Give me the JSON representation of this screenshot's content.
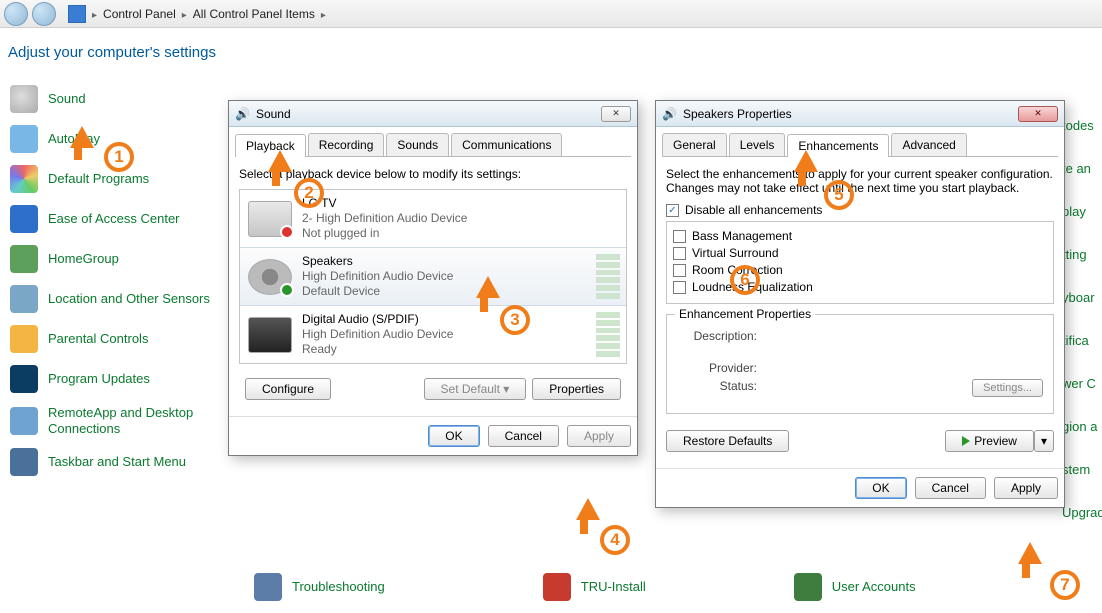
{
  "breadcrumb": {
    "items": [
      "Control Panel",
      "All Control Panel Items"
    ]
  },
  "heading": "Adjust your computer's settings",
  "sidebar": {
    "items": [
      "Sound",
      "AutoPlay",
      "Default Programs",
      "Ease of Access Center",
      "HomeGroup",
      "Location and Other Sensors",
      "Parental Controls",
      "Program Updates",
      "RemoteApp and Desktop Connections",
      "Taskbar and Start Menu"
    ]
  },
  "bottom": {
    "items": [
      "Troubleshooting",
      "TRU-Install",
      "User Accounts"
    ]
  },
  "right": {
    "items": [
      "todes",
      "te an",
      "play",
      "tting",
      "yboar",
      "tifica",
      "wer C",
      "gion a",
      "stem",
      "Upgrad"
    ]
  },
  "sound_dialog": {
    "title": "Sound",
    "tabs": [
      "Playback",
      "Recording",
      "Sounds",
      "Communications"
    ],
    "active_tab": 0,
    "instruction": "Select a playback device below to modify its settings:",
    "devices": [
      {
        "name": "LG TV",
        "sub1": "2- High Definition Audio Device",
        "sub2": "Not plugged in",
        "status": "unplugged"
      },
      {
        "name": "Speakers",
        "sub1": "High Definition Audio Device",
        "sub2": "Default Device",
        "status": "default"
      },
      {
        "name": "Digital Audio (S/PDIF)",
        "sub1": "High Definition Audio Device",
        "sub2": "Ready",
        "status": "ready"
      }
    ],
    "buttons": {
      "configure": "Configure",
      "set_default": "Set Default",
      "properties": "Properties",
      "ok": "OK",
      "cancel": "Cancel",
      "apply": "Apply"
    }
  },
  "speakers_dialog": {
    "title": "Speakers Properties",
    "tabs": [
      "General",
      "Levels",
      "Enhancements",
      "Advanced"
    ],
    "active_tab": 2,
    "instruction": "Select the enhancements to apply for your current speaker configuration. Changes may not take effect until the next time you start playback.",
    "disable_all": {
      "label": "Disable all enhancements",
      "checked": true
    },
    "enhancements": [
      {
        "label": "Bass Management",
        "checked": false
      },
      {
        "label": "Virtual Surround",
        "checked": false
      },
      {
        "label": "Room Correction",
        "checked": false
      },
      {
        "label": "Loudness Equalization",
        "checked": false
      }
    ],
    "props_group": "Enhancement Properties",
    "props": {
      "description": "Description:",
      "provider": "Provider:",
      "status": "Status:"
    },
    "buttons": {
      "settings": "Settings...",
      "restore": "Restore Defaults",
      "preview": "Preview",
      "ok": "OK",
      "cancel": "Cancel",
      "apply": "Apply"
    }
  },
  "annotations": {
    "n1": "1",
    "n2": "2",
    "n3": "3",
    "n4": "4",
    "n5": "5",
    "n6": "6",
    "n7": "7"
  }
}
